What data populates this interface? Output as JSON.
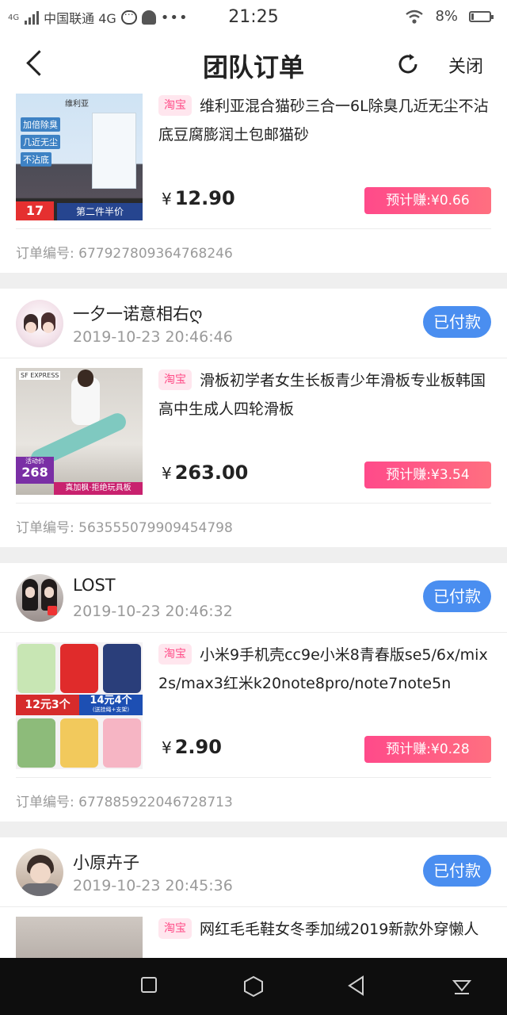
{
  "status_bar": {
    "network_small": "4G",
    "carrier": "中国联通 4G",
    "time": "21:25",
    "battery": "8%"
  },
  "nav": {
    "title": "团队订单",
    "close_label": "关闭"
  },
  "orders": [
    {
      "product": {
        "tag": "淘宝",
        "title": "维利亚混合猫砂三合一6L除臭几近无尘不沾底豆腐膨润土包邮猫砂",
        "price_symbol": "¥",
        "price": "12.90",
        "earn": "预计赚:¥0.66",
        "image_texts": [
          "加倍除臭",
          "几近无尘",
          "不沾底",
          "第二件半价",
          "17",
          "维利亚"
        ]
      },
      "order_no": "订单编号: 677927809364768246"
    },
    {
      "user": {
        "name": "一夕一诺意相右ღ",
        "date": "2019-10-23 20:46:46",
        "status": "已付款"
      },
      "product": {
        "tag": "淘宝",
        "title": "滑板初学者女生长板青少年滑板专业板韩国高中生成人四轮滑板",
        "price_symbol": "¥",
        "price": "263.00",
        "earn": "预计赚:¥3.54",
        "image_texts": [
          "SF EXPRESS",
          "268",
          "真加枫·拒绝玩具板",
          "活动价"
        ]
      },
      "order_no": "订单编号: 563555079909454798"
    },
    {
      "user": {
        "name": "LOST",
        "date": "2019-10-23 20:46:32",
        "status": "已付款"
      },
      "product": {
        "tag": "淘宝",
        "title": "小米9手机壳cc9e小米8青春版se5/6x/mix2s/max3红米k20note8pro/note7note5n",
        "price_symbol": "¥",
        "price": "2.90",
        "earn": "预计赚:¥0.28",
        "image_texts": [
          "12元3个",
          "14元4个",
          "(送挂绳+支架)"
        ]
      },
      "order_no": "订单编号: 677885922046728713"
    },
    {
      "user": {
        "name": "小原卉子",
        "date": "2019-10-23 20:45:36",
        "status": "已付款"
      },
      "product": {
        "tag": "淘宝",
        "title": "网红毛毛鞋女冬季加绒2019新款外穿懒人"
      }
    }
  ],
  "colors": {
    "status_blue": "#4a8ef0",
    "earn_pink": "#ff4a8a",
    "tag_pink": "#ff4d88"
  }
}
